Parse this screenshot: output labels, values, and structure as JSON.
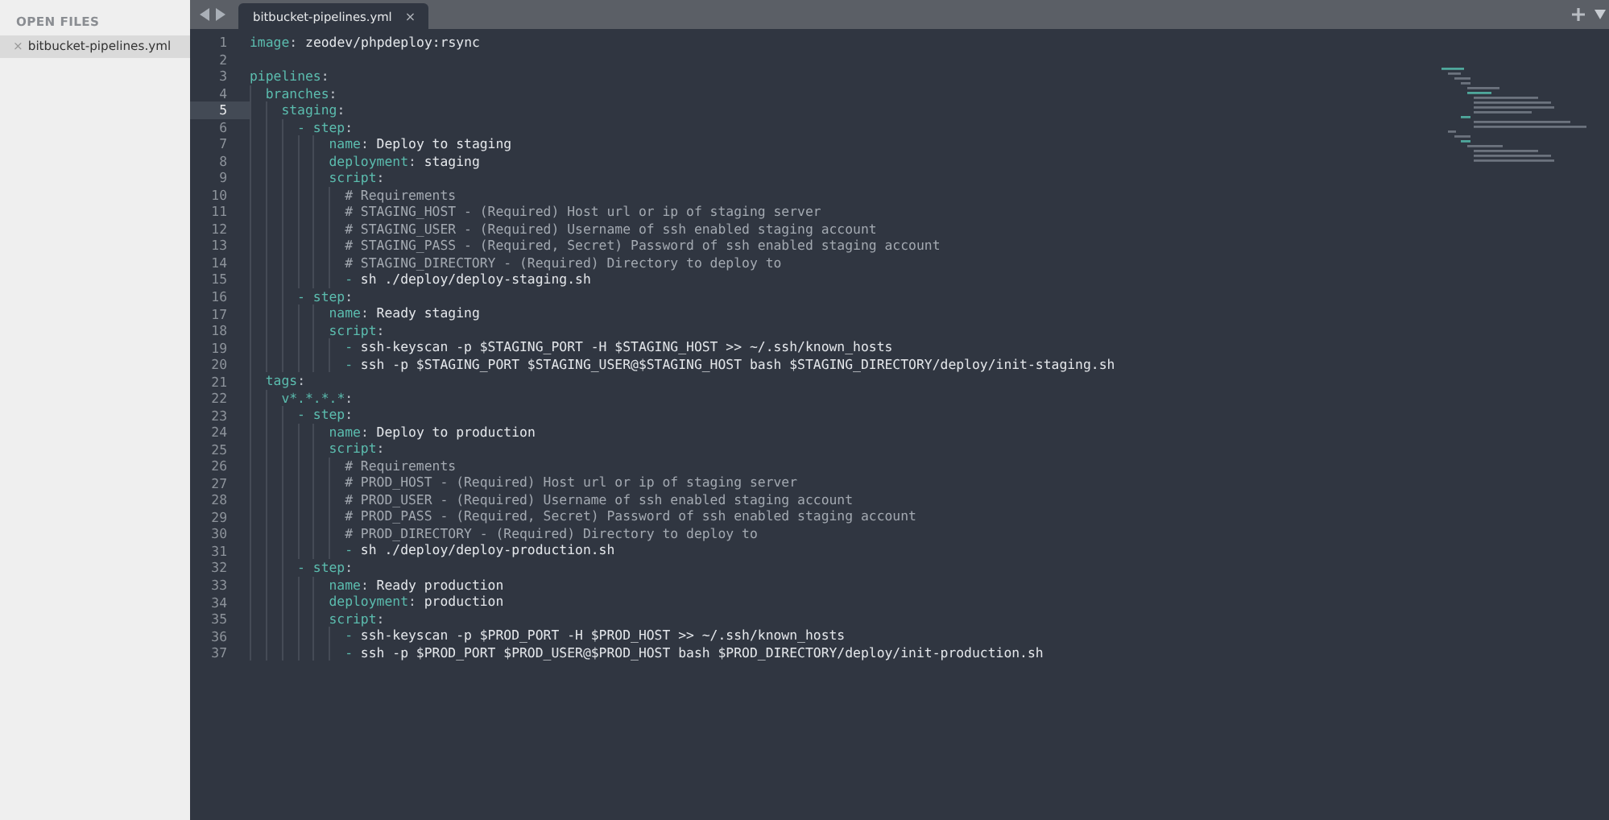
{
  "sidebar": {
    "title": "OPEN FILES",
    "files": [
      {
        "close": "×",
        "name": "bitbucket-pipelines.yml",
        "selected": true
      }
    ]
  },
  "tabs": [
    {
      "label": "bitbucket-pipelines.yml",
      "close": "×",
      "selected": true
    }
  ],
  "lines": [
    {
      "number": "1",
      "current": false,
      "parts": [
        {
          "kind": "key",
          "text": "image"
        },
        {
          "kind": "punct",
          "text": ": "
        },
        {
          "kind": "text",
          "text": "zeodev/phpdeploy:rsync"
        }
      ]
    },
    {
      "number": "2",
      "current": false
    },
    {
      "number": "3",
      "current": false,
      "parts": [
        {
          "kind": "key",
          "text": "pipelines"
        },
        {
          "kind": "punct",
          "text": ":"
        }
      ],
      "children": [
        {
          "number": "4",
          "current": false,
          "parts": [
            {
              "kind": "key",
              "text": "branches"
            },
            {
              "kind": "punct",
              "text": ":"
            }
          ],
          "children": [
            {
              "number": "5",
              "current": true,
              "parts": [
                {
                  "kind": "key",
                  "text": "staging"
                },
                {
                  "kind": "punct",
                  "text": ":"
                }
              ],
              "children": [
                {
                  "number": "6",
                  "current": false,
                  "parts": [
                    {
                      "kind": "dash",
                      "text": "- "
                    },
                    {
                      "kind": "key",
                      "text": "step"
                    },
                    {
                      "kind": "punct",
                      "text": ":"
                    }
                  ],
                  "children": [
                    {
                      "number": "7",
                      "current": false,
                      "parts": [
                        {
                          "kind": "key",
                          "text": "name"
                        },
                        {
                          "kind": "punct",
                          "text": ": "
                        },
                        {
                          "kind": "text",
                          "text": "Deploy to staging"
                        }
                      ]
                    },
                    {
                      "number": "8",
                      "current": false,
                      "parts": [
                        {
                          "kind": "key",
                          "text": "deployment"
                        },
                        {
                          "kind": "punct",
                          "text": ": "
                        },
                        {
                          "kind": "text",
                          "text": "staging"
                        }
                      ]
                    },
                    {
                      "number": "9",
                      "current": false,
                      "parts": [
                        {
                          "kind": "key",
                          "text": "script"
                        },
                        {
                          "kind": "punct",
                          "text": ":"
                        }
                      ],
                      "children": [
                        {
                          "number": "10",
                          "current": false,
                          "parts": [
                            {
                              "kind": "comment",
                              "text": "# Requirements"
                            }
                          ]
                        },
                        {
                          "number": "11",
                          "current": false,
                          "parts": [
                            {
                              "kind": "comment",
                              "text": "# STAGING_HOST - (Required) Host url or ip of staging server"
                            }
                          ]
                        },
                        {
                          "number": "12",
                          "current": false,
                          "parts": [
                            {
                              "kind": "comment",
                              "text": "# STAGING_USER - (Required) Username of ssh enabled staging account"
                            }
                          ]
                        },
                        {
                          "number": "13",
                          "current": false,
                          "parts": [
                            {
                              "kind": "comment",
                              "text": "# STAGING_PASS - (Required, Secret) Password of ssh enabled staging account"
                            }
                          ]
                        },
                        {
                          "number": "14",
                          "current": false,
                          "parts": [
                            {
                              "kind": "comment",
                              "text": "# STAGING_DIRECTORY - (Required) Directory to deploy to"
                            }
                          ]
                        },
                        {
                          "number": "15",
                          "current": false,
                          "parts": [
                            {
                              "kind": "dash",
                              "text": "- "
                            },
                            {
                              "kind": "text",
                              "text": "sh ./deploy/deploy-staging.sh"
                            }
                          ]
                        }
                      ]
                    }
                  ]
                },
                {
                  "number": "16",
                  "current": false,
                  "parts": [
                    {
                      "kind": "dash",
                      "text": "- "
                    },
                    {
                      "kind": "key",
                      "text": "step"
                    },
                    {
                      "kind": "punct",
                      "text": ":"
                    }
                  ],
                  "children": [
                    {
                      "number": "17",
                      "current": false,
                      "parts": [
                        {
                          "kind": "key",
                          "text": "name"
                        },
                        {
                          "kind": "punct",
                          "text": ": "
                        },
                        {
                          "kind": "text",
                          "text": "Ready staging"
                        }
                      ]
                    },
                    {
                      "number": "18",
                      "current": false,
                      "parts": [
                        {
                          "kind": "key",
                          "text": "script"
                        },
                        {
                          "kind": "punct",
                          "text": ":"
                        }
                      ],
                      "children": [
                        {
                          "number": "19",
                          "current": false,
                          "parts": [
                            {
                              "kind": "dash",
                              "text": "- "
                            },
                            {
                              "kind": "text",
                              "text": "ssh-keyscan -p $STAGING_PORT -H $STAGING_HOST >> ~/.ssh/known_hosts"
                            }
                          ]
                        },
                        {
                          "number": "20",
                          "current": false,
                          "parts": [
                            {
                              "kind": "dash",
                              "text": "- "
                            },
                            {
                              "kind": "text",
                              "text": "ssh -p $STAGING_PORT $STAGING_USER@$STAGING_HOST bash $STAGING_DIRECTORY/deploy/init-staging.sh"
                            }
                          ]
                        }
                      ]
                    }
                  ]
                }
              ]
            }
          ]
        },
        {
          "number": "21",
          "current": false,
          "parts": [
            {
              "kind": "key",
              "text": "tags"
            },
            {
              "kind": "punct",
              "text": ":"
            }
          ],
          "children": [
            {
              "number": "22",
              "current": false,
              "parts": [
                {
                  "kind": "key",
                  "text": "v*.*.*.*"
                },
                {
                  "kind": "punct",
                  "text": ":"
                }
              ],
              "children": [
                {
                  "number": "23",
                  "current": false,
                  "parts": [
                    {
                      "kind": "dash",
                      "text": "- "
                    },
                    {
                      "kind": "key",
                      "text": "step"
                    },
                    {
                      "kind": "punct",
                      "text": ":"
                    }
                  ],
                  "children": [
                    {
                      "number": "24",
                      "current": false,
                      "parts": [
                        {
                          "kind": "key",
                          "text": "name"
                        },
                        {
                          "kind": "punct",
                          "text": ": "
                        },
                        {
                          "kind": "text",
                          "text": "Deploy to production"
                        }
                      ]
                    },
                    {
                      "number": "25",
                      "current": false,
                      "parts": [
                        {
                          "kind": "key",
                          "text": "script"
                        },
                        {
                          "kind": "punct",
                          "text": ":"
                        }
                      ],
                      "children": [
                        {
                          "number": "26",
                          "current": false,
                          "parts": [
                            {
                              "kind": "comment",
                              "text": "# Requirements"
                            }
                          ]
                        },
                        {
                          "number": "27",
                          "current": false,
                          "parts": [
                            {
                              "kind": "comment",
                              "text": "# PROD_HOST - (Required) Host url or ip of staging server"
                            }
                          ]
                        },
                        {
                          "number": "28",
                          "current": false,
                          "parts": [
                            {
                              "kind": "comment",
                              "text": "# PROD_USER - (Required) Username of ssh enabled staging account"
                            }
                          ]
                        },
                        {
                          "number": "29",
                          "current": false,
                          "parts": [
                            {
                              "kind": "comment",
                              "text": "# PROD_PASS - (Required, Secret) Password of ssh enabled staging account"
                            }
                          ]
                        },
                        {
                          "number": "30",
                          "current": false,
                          "parts": [
                            {
                              "kind": "comment",
                              "text": "# PROD_DIRECTORY - (Required) Directory to deploy to"
                            }
                          ]
                        },
                        {
                          "number": "31",
                          "current": false,
                          "parts": [
                            {
                              "kind": "dash",
                              "text": "- "
                            },
                            {
                              "kind": "text",
                              "text": "sh ./deploy/deploy-production.sh"
                            }
                          ]
                        }
                      ]
                    }
                  ]
                },
                {
                  "number": "32",
                  "current": false,
                  "parts": [
                    {
                      "kind": "dash",
                      "text": "- "
                    },
                    {
                      "kind": "key",
                      "text": "step"
                    },
                    {
                      "kind": "punct",
                      "text": ":"
                    }
                  ],
                  "children": [
                    {
                      "number": "33",
                      "current": false,
                      "parts": [
                        {
                          "kind": "key",
                          "text": "name"
                        },
                        {
                          "kind": "punct",
                          "text": ": "
                        },
                        {
                          "kind": "text",
                          "text": "Ready production"
                        }
                      ]
                    },
                    {
                      "number": "34",
                      "current": false,
                      "parts": [
                        {
                          "kind": "key",
                          "text": "deployment"
                        },
                        {
                          "kind": "punct",
                          "text": ": "
                        },
                        {
                          "kind": "text",
                          "text": "production"
                        }
                      ]
                    },
                    {
                      "number": "35",
                      "current": false,
                      "parts": [
                        {
                          "kind": "key",
                          "text": "script"
                        },
                        {
                          "kind": "punct",
                          "text": ":"
                        }
                      ],
                      "children": [
                        {
                          "number": "36",
                          "current": false,
                          "parts": [
                            {
                              "kind": "dash",
                              "text": "- "
                            },
                            {
                              "kind": "text",
                              "text": "ssh-keyscan -p $PROD_PORT -H $PROD_HOST >> ~/.ssh/known_hosts"
                            }
                          ]
                        },
                        {
                          "number": "37",
                          "current": false,
                          "parts": [
                            {
                              "kind": "dash",
                              "text": "- "
                            },
                            {
                              "kind": "text",
                              "text": "ssh -p $PROD_PORT $PROD_USER@$PROD_HOST bash $PROD_DIRECTORY/deploy/init-production.sh"
                            }
                          ]
                        }
                      ]
                    }
                  ]
                }
              ]
            }
          ]
        }
      ]
    }
  ]
}
